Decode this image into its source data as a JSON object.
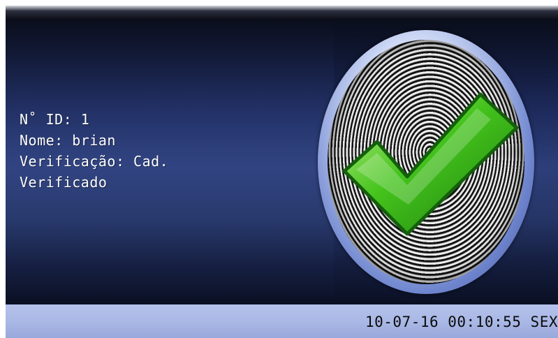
{
  "info": {
    "id_line": "N˚ ID: 1",
    "name_line": "Nome: brian",
    "verification_line": "Verificação: Cad.",
    "result_line": "Verificado"
  },
  "badge": {
    "icon": "fingerprint-checkmark-icon",
    "check_color": "#3fbf1f",
    "check_outline": "#145f0c"
  },
  "status_bar": {
    "datetime": "10-07-16 00:10:55 SEX"
  }
}
